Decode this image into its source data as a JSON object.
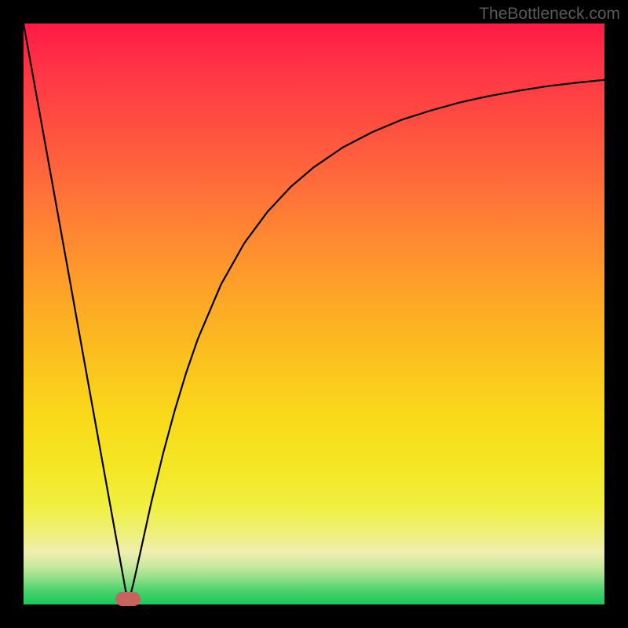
{
  "watermark": "TheBottleneck.com",
  "colors": {
    "curve": "#000000",
    "marker": "#c9635f",
    "frame": "#000000"
  },
  "chart_data": {
    "type": "line",
    "title": "",
    "xlabel": "",
    "ylabel": "",
    "xlim": [
      0,
      100
    ],
    "ylim": [
      0,
      100
    ],
    "grid": false,
    "legend": false,
    "series": [
      {
        "name": "curve",
        "x": [
          0,
          2,
          4,
          6,
          8,
          10,
          12,
          14,
          16,
          17,
          18,
          19,
          20,
          22,
          24,
          26,
          28,
          30,
          34,
          38,
          42,
          46,
          50,
          55,
          60,
          65,
          70,
          75,
          80,
          85,
          90,
          95,
          100
        ],
        "y": [
          100,
          88.9,
          77.8,
          66.7,
          55.6,
          44.4,
          33.3,
          22.2,
          11.1,
          5.6,
          0,
          4.0,
          8.5,
          17.6,
          25.9,
          33.3,
          39.9,
          45.7,
          55.1,
          62.2,
          67.6,
          71.9,
          75.3,
          78.7,
          81.3,
          83.4,
          85.0,
          86.4,
          87.5,
          88.4,
          89.2,
          89.8,
          90.3
        ]
      }
    ],
    "marker": {
      "x_center": 18,
      "x_half_width": 2.2,
      "y": 0
    }
  }
}
